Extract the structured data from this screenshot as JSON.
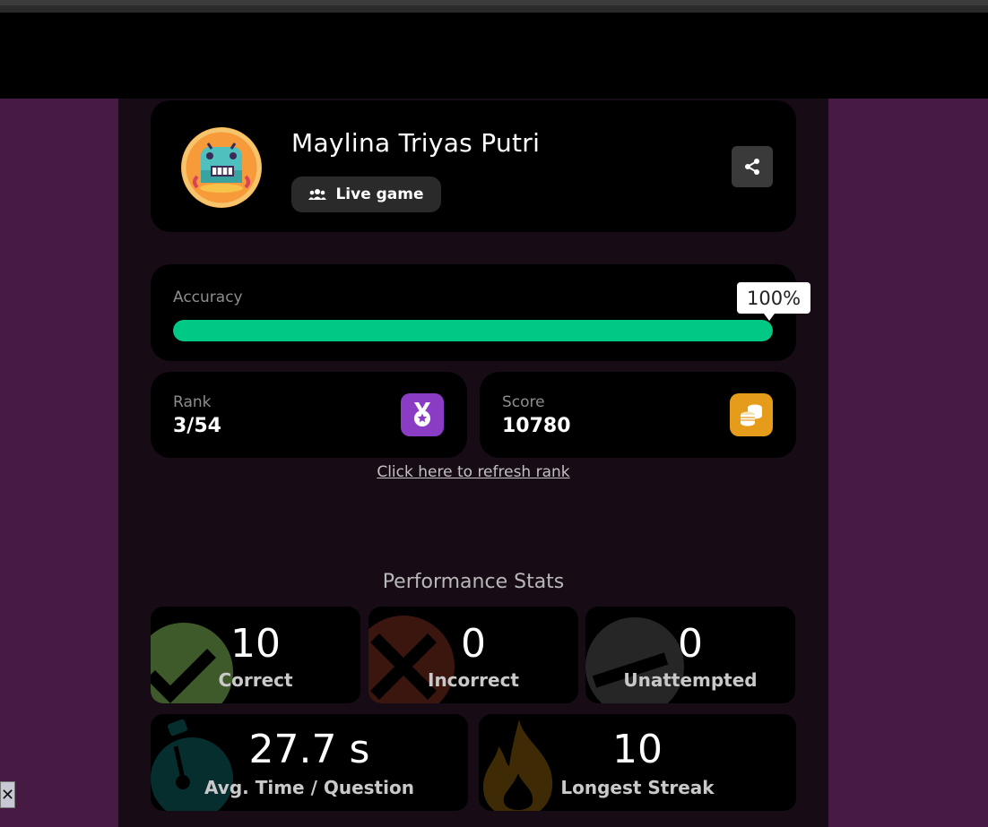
{
  "player": {
    "name": "Maylina Triyas Putri",
    "mode_label": "Live game",
    "avatar": "crab-monster-avatar"
  },
  "accuracy": {
    "label": "Accuracy",
    "value_label": "100%",
    "fraction": 1.0
  },
  "rank": {
    "label": "Rank",
    "value": "3/54",
    "icon": "medal-icon"
  },
  "score": {
    "label": "Score",
    "value": "10780",
    "icon": "coins-icon"
  },
  "refresh_link": "Click here to refresh rank",
  "performance": {
    "title": "Performance Stats",
    "correct": {
      "value": "10",
      "label": "Correct"
    },
    "incorrect": {
      "value": "0",
      "label": "Incorrect"
    },
    "unattempted": {
      "value": "0",
      "label": "Unattempted"
    },
    "avg_time": {
      "value": "27.7 s",
      "label": "Avg. Time / Question"
    },
    "streak": {
      "value": "10",
      "label": "Longest Streak"
    }
  },
  "colors": {
    "page_bg": "#461a42",
    "progress": "#00c985",
    "rank_icon": "#8a3cc4",
    "score_icon": "#e59c1a"
  }
}
